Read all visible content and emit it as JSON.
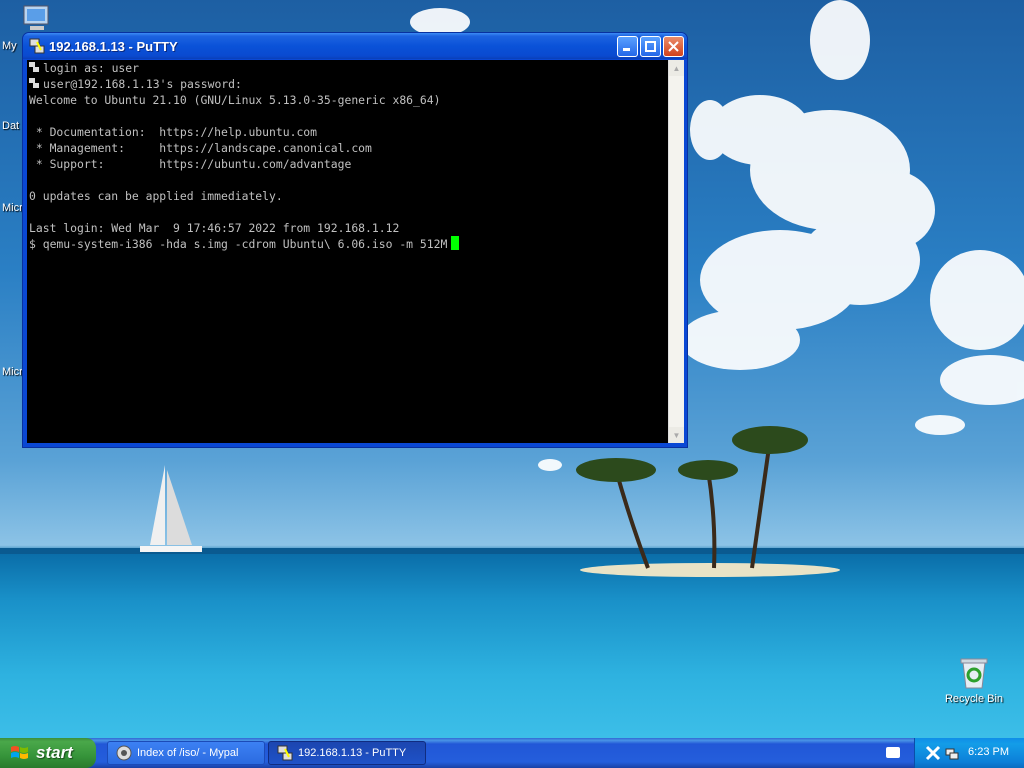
{
  "desktop": {
    "icons": [
      {
        "label": "My",
        "name": "my-computer"
      },
      {
        "label": "Dat",
        "name": "data"
      },
      {
        "label": "Micr",
        "name": "microsoft-1"
      },
      {
        "label": "Micr",
        "name": "microsoft-2"
      }
    ],
    "recycle_bin": "Recycle Bin"
  },
  "window": {
    "title": "192.168.1.13 - PuTTY",
    "terminal": {
      "lines": [
        {
          "icon": true,
          "text": "login as: user"
        },
        {
          "icon": true,
          "text": "user@192.168.1.13's password:"
        },
        {
          "icon": false,
          "text": "Welcome to Ubuntu 21.10 (GNU/Linux 5.13.0-35-generic x86_64)"
        },
        {
          "icon": false,
          "text": ""
        },
        {
          "icon": false,
          "text": " * Documentation:  https://help.ubuntu.com"
        },
        {
          "icon": false,
          "text": " * Management:     https://landscape.canonical.com"
        },
        {
          "icon": false,
          "text": " * Support:        https://ubuntu.com/advantage"
        },
        {
          "icon": false,
          "text": ""
        },
        {
          "icon": false,
          "text": "0 updates can be applied immediately."
        },
        {
          "icon": false,
          "text": ""
        },
        {
          "icon": false,
          "text": "Last login: Wed Mar  9 17:46:57 2022 from 192.168.1.12"
        },
        {
          "icon": false,
          "text": "$ qemu-system-i386 -hda s.img -cdrom Ubuntu\\ 6.06.iso -m 512M"
        }
      ],
      "cursor_color": "#00ff00"
    }
  },
  "taskbar": {
    "start_label": "start",
    "tasks": [
      {
        "label": "Index of /iso/ - Mypal",
        "active": false
      },
      {
        "label": "192.168.1.13 - PuTTY",
        "active": true
      }
    ],
    "clock": "6:23 PM"
  },
  "colors": {
    "titlebar": "#0a52d8",
    "terminal_bg": "#000000",
    "terminal_fg": "#c0c0c0",
    "start_green": "#36943a"
  }
}
